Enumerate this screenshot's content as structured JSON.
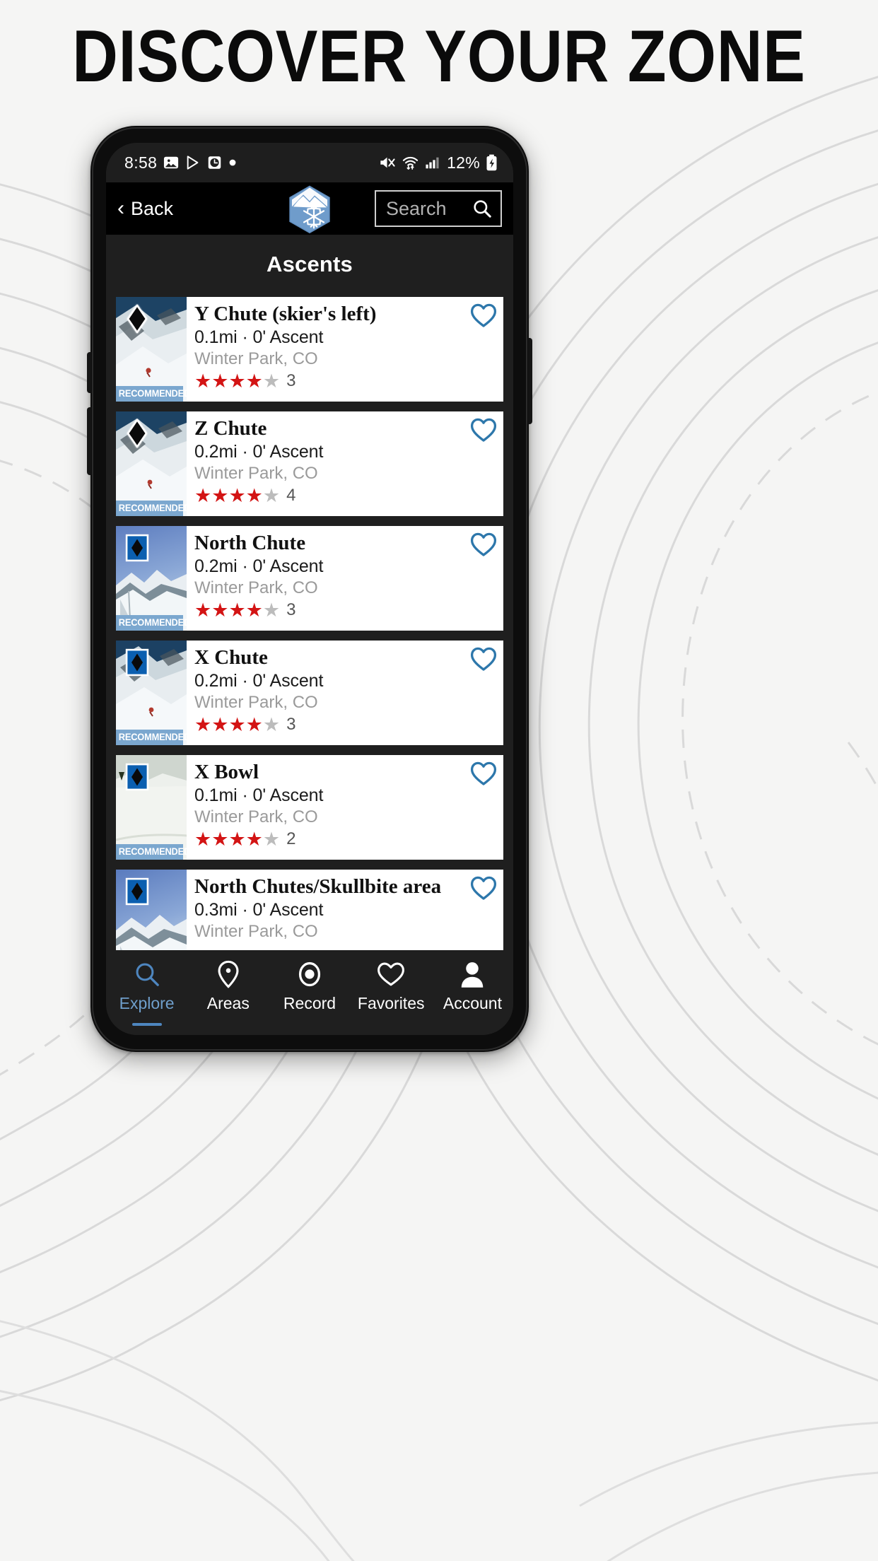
{
  "promo": {
    "headline": "DISCOVER YOUR ZONE"
  },
  "status_bar": {
    "time": "8:58",
    "battery_percent": "12%",
    "icons": [
      "image-icon",
      "play-store-icon",
      "clock-icon",
      "dot-icon",
      "mute-icon",
      "wifi-icon",
      "signal-icon",
      "battery-charging-icon"
    ]
  },
  "nav": {
    "back_label": "Back",
    "brand_icon": "snowflake-mountain-hexagon-logo",
    "search_placeholder": "Search",
    "search_value": "",
    "search_icon": "search-icon"
  },
  "page": {
    "title": "Ascents"
  },
  "colors": {
    "accent_blue": "#4e86bf",
    "ribbon_blue": "#7ba7cf",
    "star_red": "#d31414",
    "star_gray": "#bcbcbc",
    "heart_blue": "#2d77ab",
    "screen_bg": "#1f1f1f"
  },
  "routes": [
    {
      "title": "Y Chute (skier's left)",
      "stats": "0.1mi · 0' Ascent",
      "location": "Winter Park, CO",
      "stars_filled": 4,
      "stars_total": 5,
      "rating_count": "3",
      "badge": "RECOMMENDED ROUTE",
      "difficulty_icon": "black-diamond-icon",
      "favorite_icon": "heart-outline-icon"
    },
    {
      "title": "Z Chute",
      "stats": "0.2mi · 0' Ascent",
      "location": "Winter Park, CO",
      "stars_filled": 4,
      "stars_total": 5,
      "rating_count": "4",
      "badge": "RECOMMENDED ROUTE",
      "difficulty_icon": "black-diamond-icon",
      "favorite_icon": "heart-outline-icon"
    },
    {
      "title": "North Chute",
      "stats": "0.2mi · 0' Ascent",
      "location": "Winter Park, CO",
      "stars_filled": 4,
      "stars_total": 5,
      "rating_count": "3",
      "badge": "RECOMMENDED ROUTE",
      "difficulty_icon": "blue-square-black-diamond-icon",
      "favorite_icon": "heart-outline-icon"
    },
    {
      "title": "X Chute",
      "stats": "0.2mi · 0' Ascent",
      "location": "Winter Park, CO",
      "stars_filled": 4,
      "stars_total": 5,
      "rating_count": "3",
      "badge": "RECOMMENDED ROUTE",
      "difficulty_icon": "blue-square-black-diamond-icon",
      "favorite_icon": "heart-outline-icon"
    },
    {
      "title": "X Bowl",
      "stats": "0.1mi · 0' Ascent",
      "location": "Winter Park, CO",
      "stars_filled": 4,
      "stars_total": 5,
      "rating_count": "2",
      "badge": "RECOMMENDED ROUTE",
      "difficulty_icon": "blue-square-black-diamond-icon",
      "favorite_icon": "heart-outline-icon"
    },
    {
      "title": "North Chutes/Skullbite area",
      "stats": "0.3mi · 0' Ascent",
      "location": "Winter Park, CO",
      "stars_filled": 0,
      "stars_total": 0,
      "rating_count": "",
      "badge": "",
      "difficulty_icon": "blue-square-black-diamond-icon",
      "favorite_icon": "heart-outline-icon"
    }
  ],
  "tabs": [
    {
      "label": "Explore",
      "icon": "search-icon",
      "active": true
    },
    {
      "label": "Areas",
      "icon": "map-pin-icon",
      "active": false
    },
    {
      "label": "Record",
      "icon": "record-icon",
      "active": false
    },
    {
      "label": "Favorites",
      "icon": "heart-icon",
      "active": false
    },
    {
      "label": "Account",
      "icon": "person-icon",
      "active": false
    }
  ]
}
